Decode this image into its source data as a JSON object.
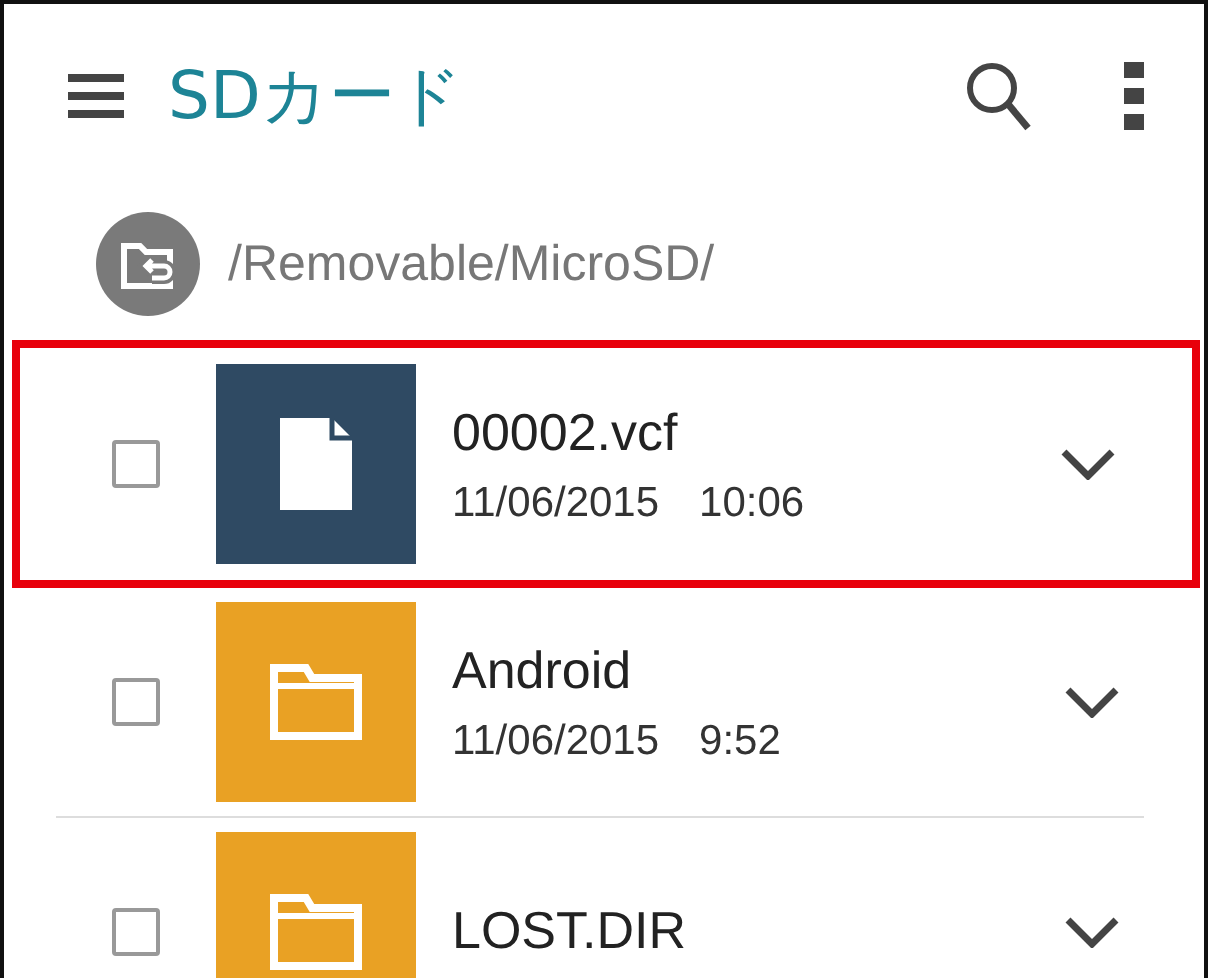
{
  "app_bar": {
    "title": "SDカード"
  },
  "path": "/Removable/MicroSD/",
  "files": [
    {
      "kind": "file",
      "name": "00002.vcf",
      "date": "11/06/2015",
      "time": "10:06",
      "checked": false,
      "highlighted": true
    },
    {
      "kind": "folder",
      "name": "Android",
      "date": "11/06/2015",
      "time": "9:52",
      "checked": false,
      "highlighted": false
    },
    {
      "kind": "folder",
      "name": "LOST.DIR",
      "checked": false,
      "highlighted": false
    }
  ]
}
